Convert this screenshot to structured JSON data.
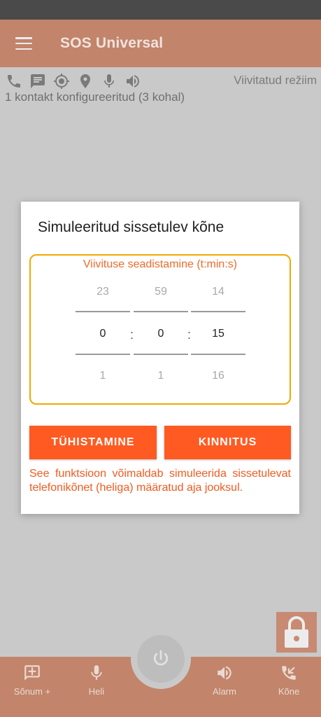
{
  "app": {
    "title": "SOS Universal",
    "mode_label": "Viivitatud režiim",
    "contact_status": "1 kontakt konfigureeritud (3 kohal)",
    "status_icons": [
      "phone-icon",
      "message-icon",
      "gps-icon",
      "location-pin-icon",
      "microphone-icon",
      "speaker-icon"
    ]
  },
  "dialog": {
    "title": "Simuleeritud sissetulev kõne",
    "picker_caption": "Viivituse seadistamine (t:min:s)",
    "hours": {
      "prev": "23",
      "current": "0",
      "next": "1"
    },
    "minutes": {
      "prev": "59",
      "current": "0",
      "next": "1"
    },
    "seconds": {
      "prev": "14",
      "current": "15",
      "next": "16"
    },
    "separator": ":",
    "cancel_label": "TÜHISTAMINE",
    "confirm_label": "KINNITUS",
    "description": "See funktsioon võimaldab simuleerida sissetulevat telefonikõnet (heliga) määratud aja jooksul."
  },
  "bottom_nav": {
    "sms_label": "Sõnum +",
    "voice_label": "Heli",
    "alarm_label": "Alarm",
    "call_label": "Kõne"
  },
  "colors": {
    "accent": "#ff5a22",
    "picker_border": "#f0a800",
    "appbar_dimmed": "#c2846a"
  }
}
